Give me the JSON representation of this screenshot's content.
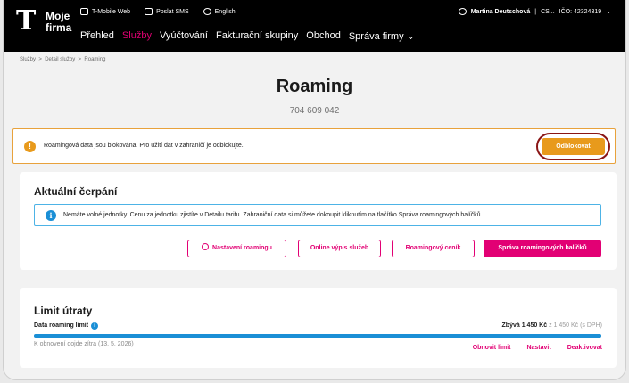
{
  "header": {
    "logo": "T",
    "brand_line1": "Moje",
    "brand_line2": "firma",
    "top_links": [
      "T-Mobile Web",
      "Poslat SMS",
      "English"
    ],
    "nav": [
      "Přehled",
      "Služby",
      "Vyúčtování",
      "Fakturační skupiny",
      "Obchod",
      "Správa firmy"
    ],
    "nav_active": "Služby",
    "user_name": "Martina Deutschová",
    "user_company": "CS...",
    "user_ico": "IČO: 42324319"
  },
  "breadcrumb": [
    "Služby",
    "Detail služby",
    "Roaming"
  ],
  "page": {
    "title": "Roaming",
    "number": "704 609 042"
  },
  "warning": {
    "text": "Roamingová data jsou blokována. Pro užití dat v zahraničí je odblokujte.",
    "button": "Odblokovat"
  },
  "current": {
    "heading": "Aktuální čerpání",
    "info": "Nemáte volné jednotky. Cenu za jednotku zjistíte v Detailu tarifu. Zahraniční data si můžete dokoupit kliknutím na tlačítko Správa roamingových balíčků.",
    "buttons": [
      "Nastavení roamingu",
      "Online výpis služeb",
      "Roamingový ceník",
      "Správa roamingových balíčků"
    ]
  },
  "limit": {
    "heading": "Limit útraty",
    "label": "Data roaming limit",
    "remaining_bold": "Zbývá 1 450 Kč",
    "remaining_rest": "z 1 450 Kč (s DPH)",
    "renew": "K obnovení dojde zítra (13. 5. 2026)",
    "actions": [
      "Obnovit limit",
      "Nastavit",
      "Deaktivovat"
    ],
    "fill_fraction": 1.0
  },
  "colors": {
    "magenta": "#e20074",
    "orange": "#e89a1c",
    "blue": "#1a8fd6"
  }
}
